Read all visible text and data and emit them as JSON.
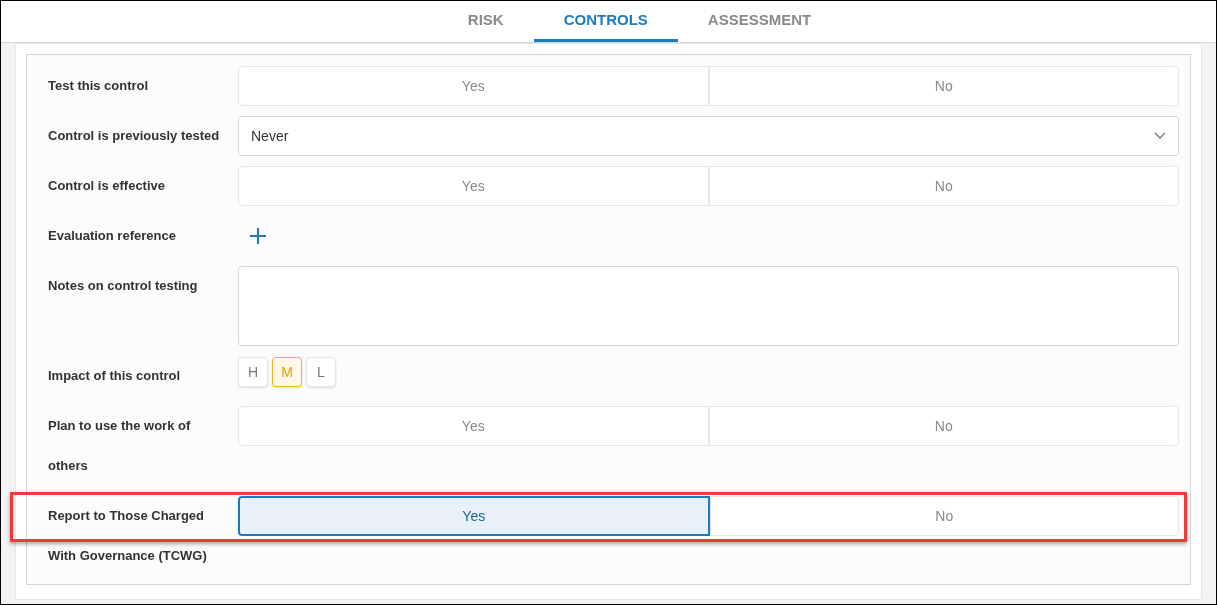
{
  "tabs": [
    {
      "label": "RISK",
      "selected": false
    },
    {
      "label": "CONTROLS",
      "selected": true
    },
    {
      "label": "ASSESSMENT",
      "selected": false
    }
  ],
  "rows": [
    {
      "kind": "toggle",
      "label": "Test this control",
      "highlighted": false,
      "options": [
        {
          "label": "Yes",
          "selected": false
        },
        {
          "label": "No",
          "selected": false
        }
      ]
    },
    {
      "kind": "select",
      "label": "Control is previously tested",
      "highlighted": false,
      "value": "Never"
    },
    {
      "kind": "toggle",
      "label": "Control is effective",
      "highlighted": false,
      "options": [
        {
          "label": "Yes",
          "selected": false
        },
        {
          "label": "No",
          "selected": false
        }
      ]
    },
    {
      "kind": "add",
      "label": "Evaluation reference",
      "highlighted": false
    },
    {
      "kind": "textarea",
      "label": "Notes on control testing",
      "highlighted": false
    },
    {
      "kind": "levels",
      "label": "Impact of this control",
      "highlighted": false,
      "options": [
        {
          "label": "H",
          "selected": false
        },
        {
          "label": "M",
          "selected": true
        },
        {
          "label": "L",
          "selected": false
        }
      ]
    },
    {
      "kind": "toggle",
      "label": "Plan to use the work of others",
      "highlighted": false,
      "options": [
        {
          "label": "Yes",
          "selected": false
        },
        {
          "label": "No",
          "selected": false
        }
      ]
    },
    {
      "kind": "toggle",
      "label": "Report to Those Charged With Governance (TCWG)",
      "highlighted": true,
      "options": [
        {
          "label": "Yes",
          "selected": true
        },
        {
          "label": "No",
          "selected": false
        }
      ]
    }
  ]
}
